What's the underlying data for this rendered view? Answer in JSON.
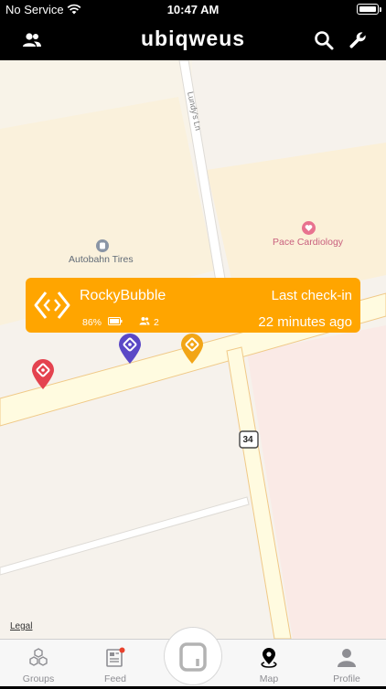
{
  "status_bar": {
    "carrier": "No Service",
    "time": "10:47 AM",
    "battery_level": 1.0
  },
  "header": {
    "title": "ubiqweus",
    "left_icon": "people-icon",
    "right_icons": [
      "search-icon",
      "wrench-icon"
    ]
  },
  "map": {
    "places": [
      {
        "name": "Autobahn Tires",
        "icon": "tire-shop-icon"
      },
      {
        "name": "Pace Cardiology",
        "icon": "heart-icon"
      }
    ],
    "street": "Lundy's Ln",
    "route_shield": "34",
    "legal": "Legal"
  },
  "callout": {
    "name": "RockyBubble",
    "battery": "86%",
    "members": "2",
    "checkin_label": "Last check-in",
    "checkin_time": "22 minutes ago",
    "color": "#ffa500"
  },
  "pins": [
    {
      "color": "#e4434f"
    },
    {
      "color": "#5a48c6"
    },
    {
      "color": "#f2a516"
    }
  ],
  "tabs": [
    {
      "label": "Groups",
      "icon": "cubes-icon",
      "active": false
    },
    {
      "label": "Feed",
      "icon": "newspaper-icon",
      "active": false,
      "badge": true
    },
    {
      "label": "",
      "icon": "ubiqweus-logo-button",
      "active": false
    },
    {
      "label": "Map",
      "icon": "map-pin-icon",
      "active": true
    },
    {
      "label": "Profile",
      "icon": "person-icon",
      "active": false
    }
  ]
}
